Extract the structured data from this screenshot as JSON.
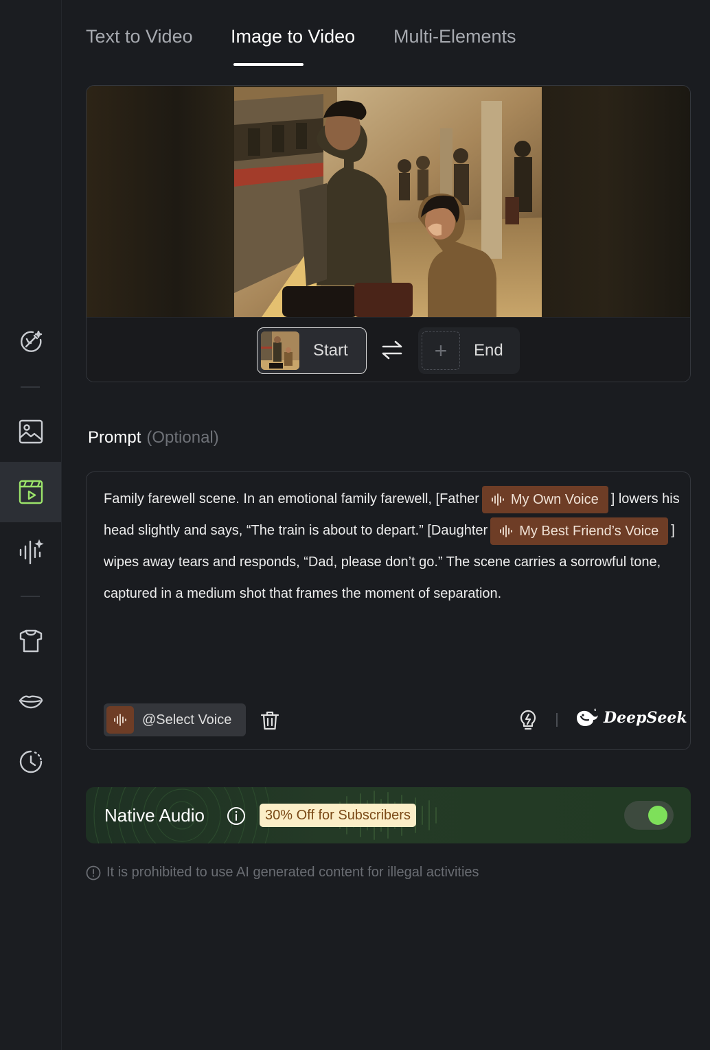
{
  "sidebar": {
    "items": [
      {
        "icon": "magic-wand-icon"
      },
      {
        "icon": "image-icon"
      },
      {
        "icon": "video-icon",
        "active": true
      },
      {
        "icon": "audio-sparkle-icon"
      },
      {
        "icon": "shirt-icon"
      },
      {
        "icon": "lips-icon"
      },
      {
        "icon": "history-icon"
      }
    ]
  },
  "tabs": [
    {
      "label": "Text to Video"
    },
    {
      "label": "Image to Video",
      "active": true
    },
    {
      "label": "Multi-Elements"
    }
  ],
  "frames": {
    "start_label": "Start",
    "end_label": "End"
  },
  "prompt": {
    "title": "Prompt",
    "optional": "(Optional)",
    "text_1": "Family farewell scene. In an emotional family farewell, [Father",
    "voice_1": "My Own Voice",
    "text_2": "] lowers his head slightly and says, “The train is about to depart.” [Daughter",
    "voice_2": "My Best Friend’s Voice",
    "text_3": "] wipes away tears and responds, “Dad, please don’t go.” The scene carries a sorrowful tone, captured in a medium shot that frames the moment of separation.",
    "select_voice_label": "@Select Voice",
    "deepseek_label": "DeepSeek"
  },
  "native_audio": {
    "title": "Native Audio",
    "promo": "30% Off for Subscribers",
    "enabled": true,
    "accent_color": "#7ee05a"
  },
  "disclaimer": "It is prohibited to use AI generated content for illegal activities"
}
